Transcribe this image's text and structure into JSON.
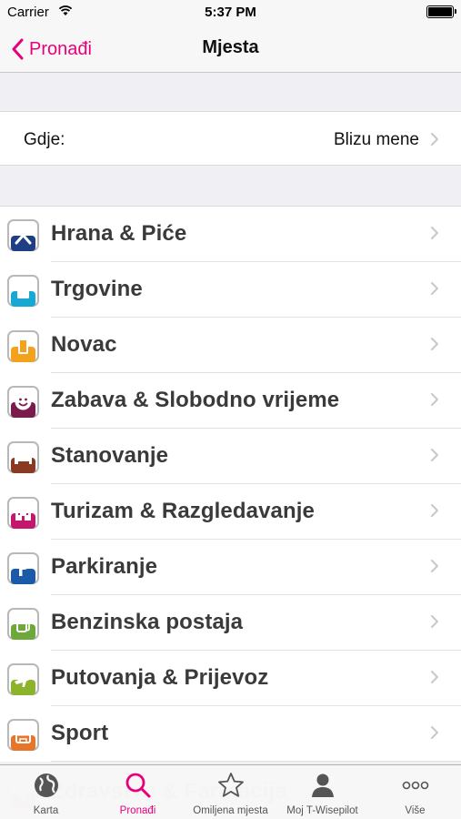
{
  "status_bar": {
    "carrier": "Carrier",
    "time": "5:37 PM"
  },
  "nav": {
    "back_label": "Pronađi",
    "title": "Mjesta"
  },
  "where": {
    "label": "Gdje:",
    "value": "Blizu mene"
  },
  "categories": [
    {
      "label": "Hrana & Piće",
      "icon": "fork-knife-icon",
      "color": "#1f3f85"
    },
    {
      "label": "Trgovine",
      "icon": "shopping-bag-icon",
      "color": "#17a9d4"
    },
    {
      "label": "Novac",
      "icon": "money-icon",
      "color": "#f4a21c"
    },
    {
      "label": "Zabava & Slobodno vrijeme",
      "icon": "smiley-icon",
      "color": "#7b1a4c"
    },
    {
      "label": "Stanovanje",
      "icon": "bed-icon",
      "color": "#8a3a22"
    },
    {
      "label": "Turizam & Razgledavanje",
      "icon": "castle-icon",
      "color": "#c4166d"
    },
    {
      "label": "Parkiranje",
      "icon": "parking-icon",
      "color": "#1b5aa8"
    },
    {
      "label": "Benzinska postaja",
      "icon": "fuel-pump-icon",
      "color": "#6ea83a"
    },
    {
      "label": "Putovanja & Prijevoz",
      "icon": "airplane-icon",
      "color": "#8bb42a"
    },
    {
      "label": "Sport",
      "icon": "sport-icon",
      "color": "#e5762a"
    }
  ],
  "partial_category": {
    "label": "Zdravstvo & Farmacija",
    "icon": "health-cross-icon",
    "color": "#d6202b"
  },
  "tabs": [
    {
      "label": "Karta",
      "icon": "globe-icon"
    },
    {
      "label": "Pronađi",
      "icon": "search-icon"
    },
    {
      "label": "Omiljena mjesta",
      "icon": "star-icon"
    },
    {
      "label": "Moj T-Wisepilot",
      "icon": "person-icon"
    },
    {
      "label": "Više",
      "icon": "more-icon"
    }
  ],
  "colors": {
    "accent": "#e6007e",
    "tab_inactive": "#555555",
    "chevron": "#c7c7cc"
  }
}
